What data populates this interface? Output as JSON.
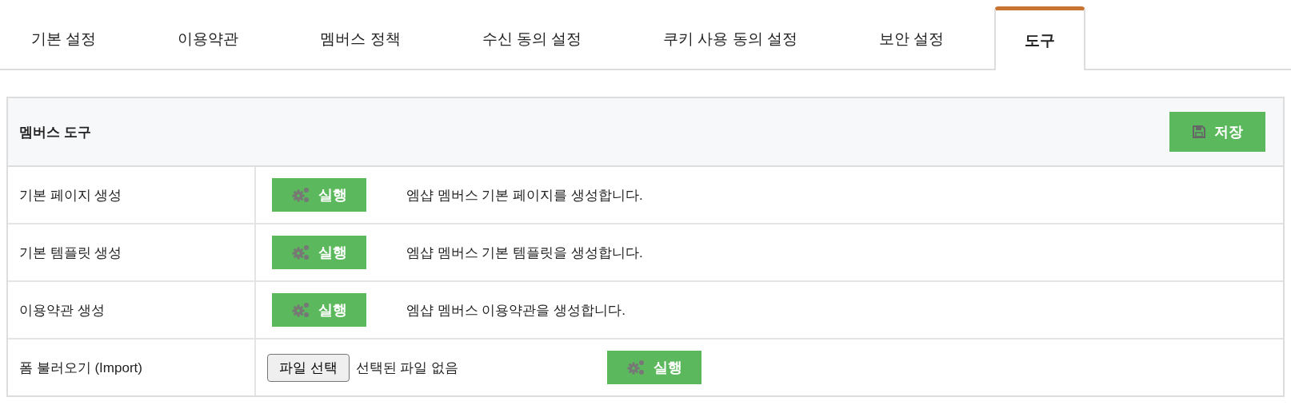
{
  "tabs": [
    {
      "label": "기본 설정",
      "selected": false
    },
    {
      "label": "이용약관",
      "selected": false
    },
    {
      "label": "멤버스 정책",
      "selected": false
    },
    {
      "label": "수신 동의 설정",
      "selected": false
    },
    {
      "label": "쿠키 사용 동의 설정",
      "selected": false
    },
    {
      "label": "보안 설정",
      "selected": false
    },
    {
      "label": "도구",
      "selected": true
    }
  ],
  "panel": {
    "title": "멤버스 도구",
    "save_button": "저장",
    "rows": [
      {
        "kind": "action",
        "label": "기본 페이지 생성",
        "button": "실행",
        "description": "엠샵 멤버스 기본 페이지를 생성합니다."
      },
      {
        "kind": "action",
        "label": "기본 템플릿 생성",
        "button": "실행",
        "description": "엠샵 멤버스 기본 템플릿을 생성합니다."
      },
      {
        "kind": "action",
        "label": "이용약관 생성",
        "button": "실행",
        "description": "엠샵 멤버스 이용약관을 생성합니다."
      },
      {
        "kind": "import",
        "label": "폼 불러오기 (Import)",
        "file_button": "파일 선택",
        "file_status": "선택된 파일 없음",
        "button": "실행"
      }
    ]
  }
}
